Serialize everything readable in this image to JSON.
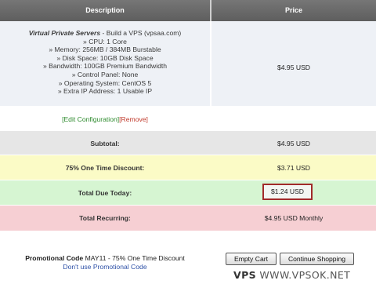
{
  "header": {
    "description_label": "Description",
    "price_label": "Price"
  },
  "product": {
    "name": "Virtual Private Servers",
    "title_rest": " - Build a VPS (vpsaa.com)",
    "specs": [
      "» CPU: 1 Core",
      "» Memory: 256MB / 384MB Burstable",
      "» Disk Space: 10GB Disk Space",
      "» Bandwidth: 100GB Premium Bandwidth",
      "» Control Panel: None",
      "» Operating System: CentOS 5",
      "» Extra IP Address: 1 Usable IP"
    ],
    "price": "$4.95 USD"
  },
  "links": {
    "edit": "[Edit Configuration]",
    "remove": "[Remove]"
  },
  "totals": {
    "subtotal_label": "Subtotal:",
    "subtotal_value": "$4.95 USD",
    "discount_label": "75% One Time Discount:",
    "discount_value": "$3.71 USD",
    "due_label": "Total Due Today:",
    "due_value": "$1.24 USD",
    "recurring_label": "Total Recurring:",
    "recurring_value": "$4.95 USD Monthly"
  },
  "promo": {
    "label": "Promotional Code",
    "text": " MAY11 - 75% One Time Discount",
    "dont_use": "Don't use Promotional Code"
  },
  "buttons": {
    "empty_cart": "Empty Cart",
    "continue": "Continue Shopping"
  },
  "watermark": {
    "mark": "VPS",
    "site": "WWW.VPSOK.NET"
  },
  "colors": {
    "header": "#686868",
    "product_bg": "#eef1f6",
    "subtotal_bg": "#e6e6e6",
    "discount_bg": "#fbfbc6",
    "due_bg": "#d6f5d2",
    "recurring_bg": "#f6cfd3",
    "highlight_border": "#a12a2a"
  }
}
